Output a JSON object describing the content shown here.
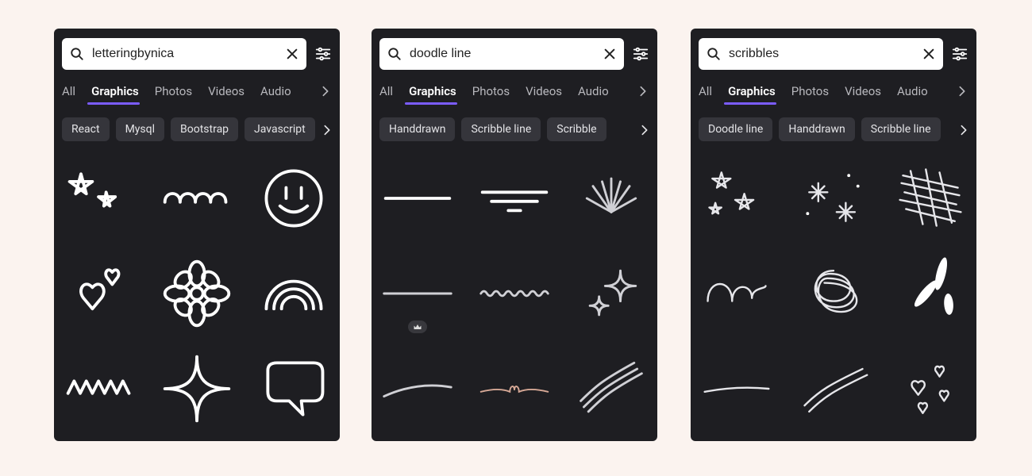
{
  "panels": [
    {
      "search": {
        "query": "letteringbynica"
      },
      "tabs": [
        "All",
        "Graphics",
        "Photos",
        "Videos",
        "Audio"
      ],
      "active_tab": "Graphics",
      "chips": [
        "React",
        "Mysql",
        "Bootstrap",
        "Javascript"
      ],
      "results": [
        "stars-doodle",
        "loop-doodle",
        "smiley-face",
        "hearts-doodle",
        "flower-doodle",
        "rainbow-doodle",
        "zigzag-doodle",
        "sparkle-diamond",
        "speech-bubble"
      ]
    },
    {
      "search": {
        "query": "doodle line"
      },
      "tabs": [
        "All",
        "Graphics",
        "Photos",
        "Videos",
        "Audio"
      ],
      "active_tab": "Graphics",
      "chips": [
        "Handdrawn",
        "Scribble line",
        "Scribble"
      ],
      "results": [
        "brush-line",
        "double-underline",
        "burst-lines",
        "thin-line",
        "squiggle-line",
        "sparkle-stars",
        "swoosh-line",
        "heart-line",
        "wave-lines"
      ],
      "premium_index": 3
    },
    {
      "search": {
        "query": "scribbles"
      },
      "tabs": [
        "All",
        "Graphics",
        "Photos",
        "Videos",
        "Audio"
      ],
      "active_tab": "Graphics",
      "chips": [
        "Doodle line",
        "Handdrawn",
        "Scribble line"
      ],
      "results": [
        "sketchy-stars",
        "sparkle-dots",
        "hatch-scribble",
        "curly-loop",
        "tangle-ball",
        "dash-burst",
        "brush-stroke",
        "flowing-lines",
        "hearts-cluster"
      ]
    }
  ]
}
